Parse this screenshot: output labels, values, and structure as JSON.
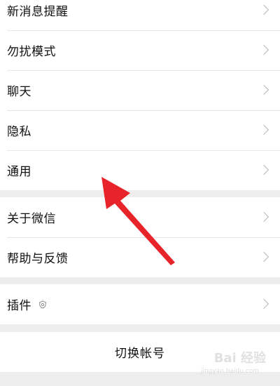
{
  "settings": {
    "group1": [
      {
        "label": "新消息提醒"
      },
      {
        "label": "勿扰模式"
      },
      {
        "label": "聊天"
      },
      {
        "label": "隐私"
      },
      {
        "label": "通用"
      }
    ],
    "group2": [
      {
        "label": "关于微信"
      },
      {
        "label": "帮助与反馈"
      }
    ],
    "group3": [
      {
        "label": "插件"
      }
    ],
    "switch_account": "切换帐号"
  },
  "annotation": {
    "arrow_color": "#e8242b"
  },
  "watermark": {
    "text": "Bai 经验",
    "sub": "jingyan.baidu.com"
  }
}
